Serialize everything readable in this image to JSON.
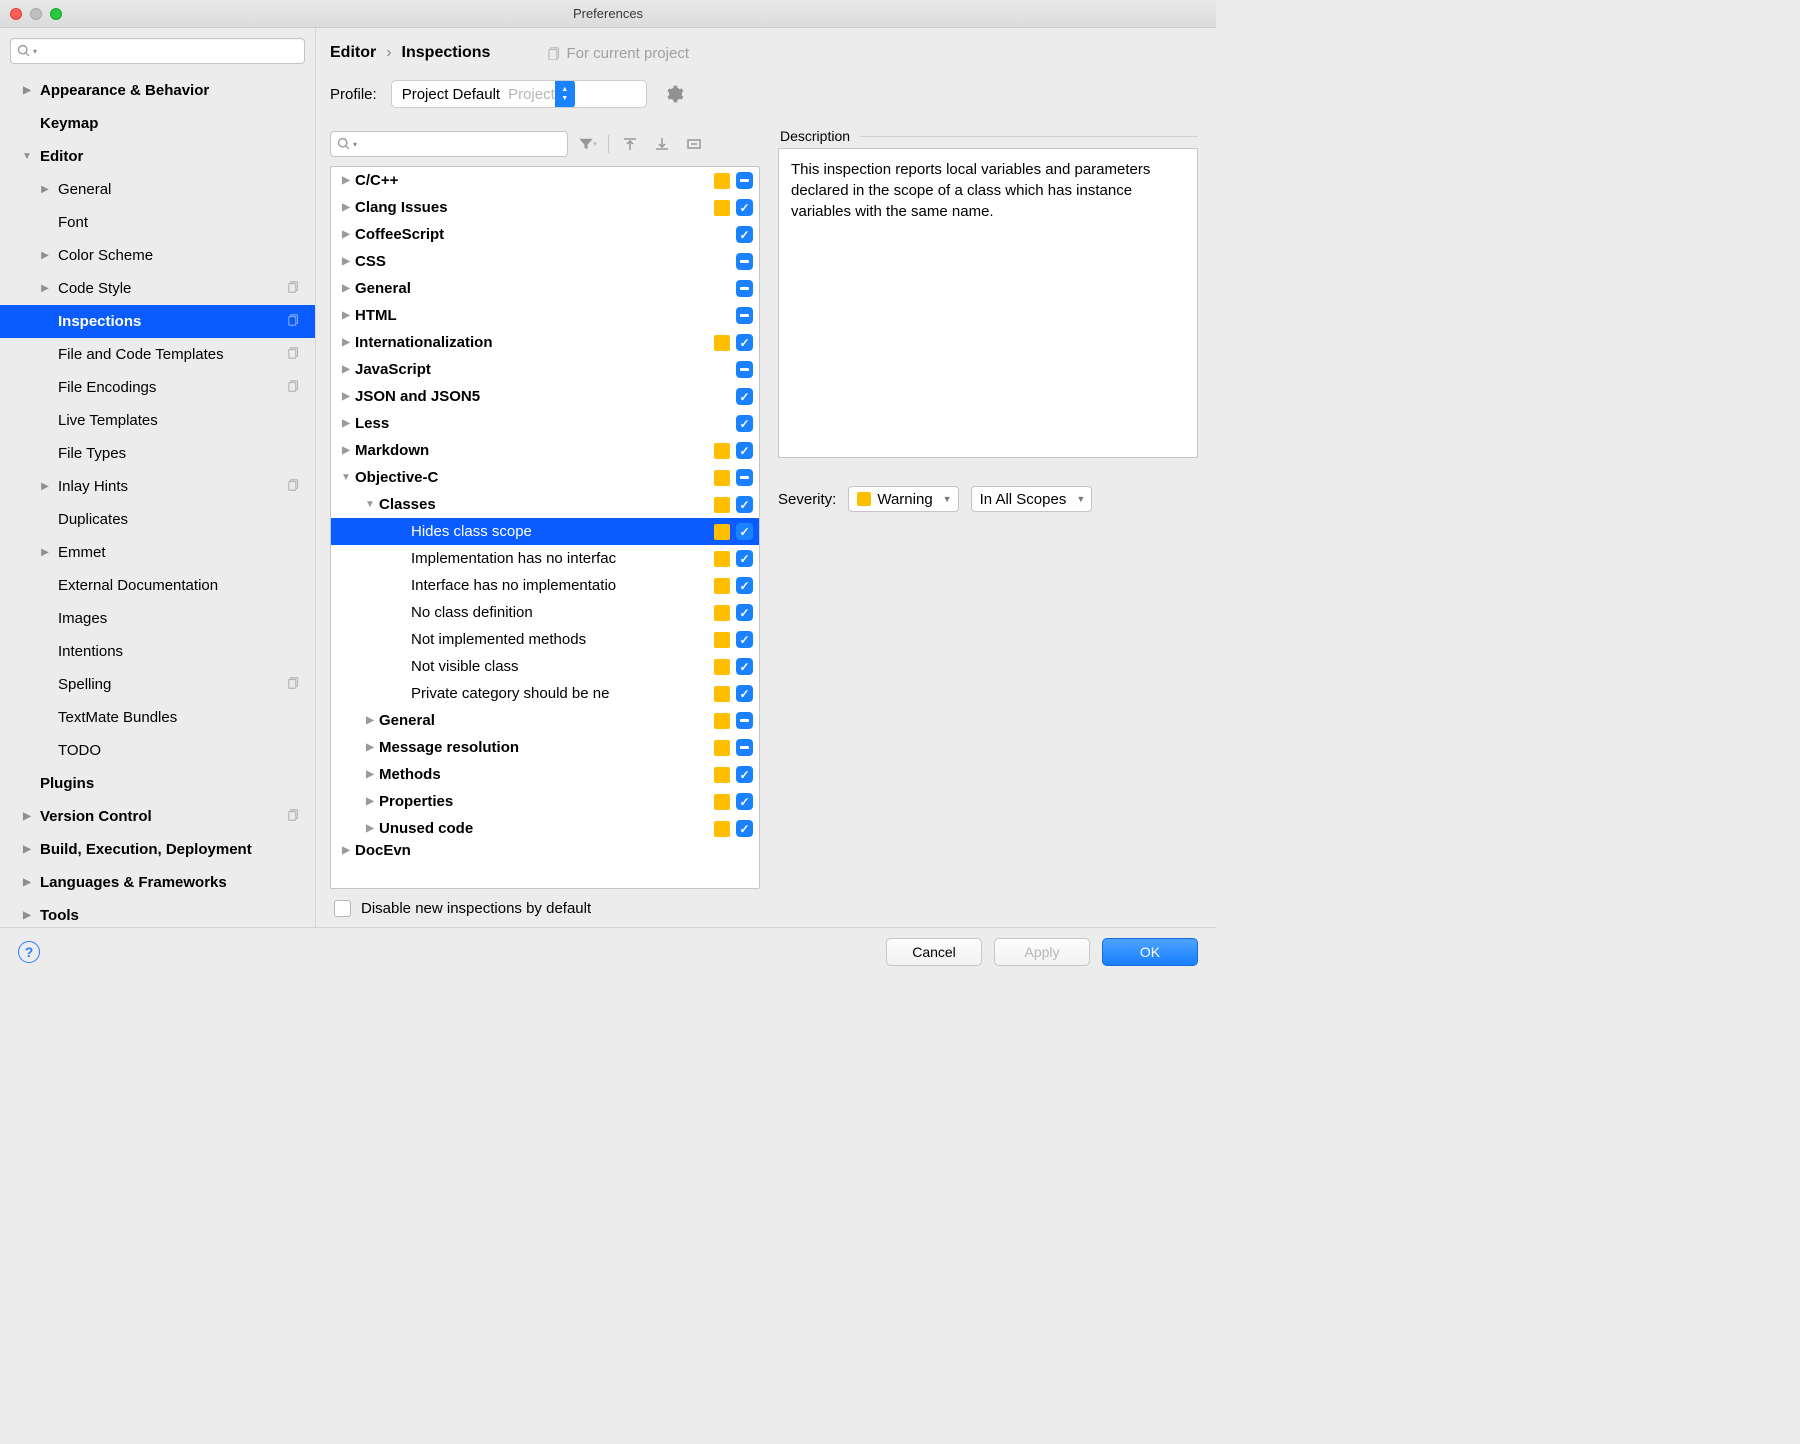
{
  "window": {
    "title": "Preferences"
  },
  "breadcrumb": {
    "parent": "Editor",
    "current": "Inspections",
    "scope_label": "For current project"
  },
  "profile": {
    "label": "Profile:",
    "name": "Project Default",
    "hint": "Project"
  },
  "sidebar": {
    "items": [
      {
        "label": "Appearance & Behavior",
        "bold": true,
        "disc": "▶"
      },
      {
        "label": "Keymap",
        "bold": true
      },
      {
        "label": "Editor",
        "bold": true,
        "disc": "▼"
      },
      {
        "label": "General",
        "sub": true,
        "disc": "▶"
      },
      {
        "label": "Font",
        "sub": true
      },
      {
        "label": "Color Scheme",
        "sub": true,
        "disc": "▶"
      },
      {
        "label": "Code Style",
        "sub": true,
        "disc": "▶",
        "copy": true
      },
      {
        "label": "Inspections",
        "sub": true,
        "sel": true,
        "copy": true
      },
      {
        "label": "File and Code Templates",
        "sub": true,
        "copy": true
      },
      {
        "label": "File Encodings",
        "sub": true,
        "copy": true
      },
      {
        "label": "Live Templates",
        "sub": true
      },
      {
        "label": "File Types",
        "sub": true
      },
      {
        "label": "Inlay Hints",
        "sub": true,
        "disc": "▶",
        "copy": true
      },
      {
        "label": "Duplicates",
        "sub": true
      },
      {
        "label": "Emmet",
        "sub": true,
        "disc": "▶"
      },
      {
        "label": "External Documentation",
        "sub": true
      },
      {
        "label": "Images",
        "sub": true
      },
      {
        "label": "Intentions",
        "sub": true
      },
      {
        "label": "Spelling",
        "sub": true,
        "copy": true
      },
      {
        "label": "TextMate Bundles",
        "sub": true
      },
      {
        "label": "TODO",
        "sub": true
      },
      {
        "label": "Plugins",
        "bold": true
      },
      {
        "label": "Version Control",
        "bold": true,
        "disc": "▶",
        "copy": true
      },
      {
        "label": "Build, Execution, Deployment",
        "bold": true,
        "disc": "▶"
      },
      {
        "label": "Languages & Frameworks",
        "bold": true,
        "disc": "▶"
      },
      {
        "label": "Tools",
        "bold": true,
        "disc": "▶"
      }
    ]
  },
  "inspections": [
    {
      "label": "C/C++",
      "depth": 0,
      "disc": "▶",
      "bold": true,
      "sev": true,
      "chk": "mixed"
    },
    {
      "label": "Clang Issues",
      "depth": 0,
      "disc": "▶",
      "bold": true,
      "sev": true,
      "chk": "checked"
    },
    {
      "label": "CoffeeScript",
      "depth": 0,
      "disc": "▶",
      "bold": true,
      "chk": "checked"
    },
    {
      "label": "CSS",
      "depth": 0,
      "disc": "▶",
      "bold": true,
      "chk": "mixed"
    },
    {
      "label": "General",
      "depth": 0,
      "disc": "▶",
      "bold": true,
      "chk": "mixed"
    },
    {
      "label": "HTML",
      "depth": 0,
      "disc": "▶",
      "bold": true,
      "chk": "mixed"
    },
    {
      "label": "Internationalization",
      "depth": 0,
      "disc": "▶",
      "bold": true,
      "sev": true,
      "chk": "checked"
    },
    {
      "label": "JavaScript",
      "depth": 0,
      "disc": "▶",
      "bold": true,
      "chk": "mixed"
    },
    {
      "label": "JSON and JSON5",
      "depth": 0,
      "disc": "▶",
      "bold": true,
      "chk": "checked"
    },
    {
      "label": "Less",
      "depth": 0,
      "disc": "▶",
      "bold": true,
      "chk": "checked"
    },
    {
      "label": "Markdown",
      "depth": 0,
      "disc": "▶",
      "bold": true,
      "sev": true,
      "chk": "checked"
    },
    {
      "label": "Objective-C",
      "depth": 0,
      "disc": "▼",
      "bold": true,
      "sev": true,
      "chk": "mixed"
    },
    {
      "label": "Classes",
      "depth": 1,
      "disc": "▼",
      "bold": true,
      "sev": true,
      "chk": "checked"
    },
    {
      "label": "Hides class scope",
      "depth": 2,
      "sel": true,
      "sev": true,
      "chk": "checked"
    },
    {
      "label": "Implementation has no interfac",
      "depth": 2,
      "sev": true,
      "chk": "checked"
    },
    {
      "label": "Interface has no implementatio",
      "depth": 2,
      "sev": true,
      "chk": "checked"
    },
    {
      "label": "No class definition",
      "depth": 2,
      "sev": true,
      "chk": "checked"
    },
    {
      "label": "Not implemented methods",
      "depth": 2,
      "sev": true,
      "chk": "checked"
    },
    {
      "label": "Not visible class",
      "depth": 2,
      "sev": true,
      "chk": "checked"
    },
    {
      "label": "Private category should be ne",
      "depth": 2,
      "sev": true,
      "chk": "checked"
    },
    {
      "label": "General",
      "depth": 1,
      "disc": "▶",
      "bold": true,
      "sev": true,
      "chk": "mixed"
    },
    {
      "label": "Message resolution",
      "depth": 1,
      "disc": "▶",
      "bold": true,
      "sev": true,
      "chk": "mixed"
    },
    {
      "label": "Methods",
      "depth": 1,
      "disc": "▶",
      "bold": true,
      "sev": true,
      "chk": "checked"
    },
    {
      "label": "Properties",
      "depth": 1,
      "disc": "▶",
      "bold": true,
      "sev": true,
      "chk": "checked"
    },
    {
      "label": "Unused code",
      "depth": 1,
      "disc": "▶",
      "bold": true,
      "sev": true,
      "chk": "checked"
    }
  ],
  "disable_label": "Disable new inspections by default",
  "desc": {
    "title": "Description",
    "text": "This inspection reports local variables and parameters declared in the scope of a class which has instance variables with the same name."
  },
  "severity": {
    "label": "Severity:",
    "value": "Warning",
    "scope": "In All Scopes"
  },
  "footer": {
    "cancel": "Cancel",
    "apply": "Apply",
    "ok": "OK"
  }
}
